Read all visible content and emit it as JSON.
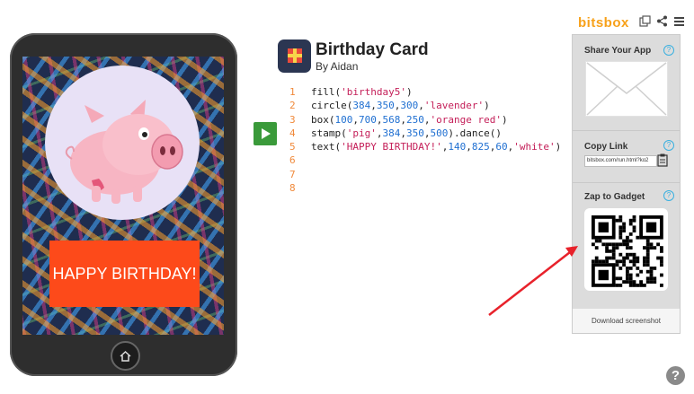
{
  "app": {
    "title": "Birthday Card",
    "author": "By Aidan"
  },
  "brand": {
    "logo": "bitsbox",
    "color": "#f7a11a"
  },
  "header_icons": [
    "copy-icon",
    "share-icon",
    "menu-icon"
  ],
  "code": {
    "lines": [
      {
        "n": "1",
        "text": "fill('birthday5')"
      },
      {
        "n": "2",
        "text": "circle(384,350,300,'lavender')"
      },
      {
        "n": "3",
        "text": "box(100,700,568,250,'orange red')"
      },
      {
        "n": "4",
        "text": "stamp('pig',384,350,500).dance()"
      },
      {
        "n": "5",
        "text": "text('HAPPY BIRTHDAY!',140,825,60,'white')"
      },
      {
        "n": "6",
        "text": ""
      },
      {
        "n": "7",
        "text": ""
      },
      {
        "n": "8",
        "text": ""
      }
    ],
    "colors": {
      "line_numbers": "#f0893a",
      "strings": "#c41e58",
      "numbers": "#1f6fd1"
    }
  },
  "phone": {
    "card_text": "HAPPY BIRTHDAY!",
    "box_color": "#fd4a1a",
    "circle_color": "#e8e1f6",
    "home_icon": "home-icon"
  },
  "panel": {
    "share_title": "Share Your App",
    "copy_title": "Copy Link",
    "link_value": "bitsbox.com/run.html?ko2",
    "zap_title": "Zap to Gadget",
    "download_label": "Download screenshot",
    "help_glyph": "?"
  },
  "play_button": {
    "icon": "play-icon",
    "color": "#3a9a3a"
  },
  "help_button": {
    "glyph": "?"
  }
}
